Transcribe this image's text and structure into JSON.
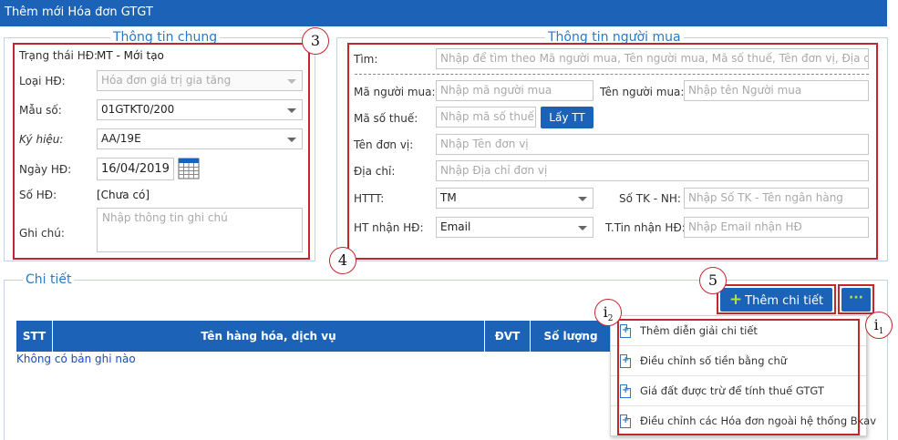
{
  "window": {
    "title": "Thêm mới Hóa đơn GTGT"
  },
  "general": {
    "legend": "Thông tin chung",
    "status_label": "Trạng thái HĐ:",
    "status_value": "MT - Mới tạo",
    "type_label": "Loại HĐ:",
    "type_value": "Hóa đơn giá trị gia tăng",
    "form_label": "Mẫu số:",
    "form_value": "01GTKT0/200",
    "symbol_label": "Ký hiệu:",
    "symbol_value": "AA/19E",
    "date_label": "Ngày HĐ:",
    "date_value": "16/04/2019",
    "number_label": "Số HĐ:",
    "number_value": "[Chưa có]",
    "note_label": "Ghi chú:",
    "note_placeholder": "Nhập thông tin ghi chú"
  },
  "buyer": {
    "legend": "Thông tin người mua",
    "search_label": "Tìm:",
    "search_placeholder": "Nhập để tìm theo Mã người mua, Tên người mua, Mã số thuế, Tên đơn vị, Địa chỉ",
    "code_label": "Mã người mua:",
    "code_placeholder": "Nhập mã người mua",
    "name_label": "Tên người mua:",
    "name_placeholder": "Nhập tên Người mua",
    "tax_label": "Mã số thuế:",
    "tax_placeholder": "Nhập mã số thuế",
    "fetch_button": "Lấy TT",
    "unit_label": "Tên đơn vị:",
    "unit_placeholder": "Nhập Tên đơn vị",
    "address_label": "Địa chỉ:",
    "address_placeholder": "Nhập Địa chỉ đơn vị",
    "payment_label": "HTTT:",
    "payment_value": "TM",
    "account_label": "Số TK - NH:",
    "account_placeholder": "Nhập Số TK - Tên ngân hàng",
    "receive_label": "HT nhận HĐ:",
    "receive_value": "Email",
    "receive_info_label": "T.Tin nhận HĐ:",
    "receive_info_placeholder": "Nhập Email nhận HĐ"
  },
  "detail": {
    "legend": "Chi tiết",
    "add_button": "Thêm chi tiết",
    "more_button": "···",
    "columns": [
      "STT",
      "Tên hàng hóa, dịch vụ",
      "ĐVT",
      "Số lượng"
    ],
    "empty_text": "Không có bản ghi nào"
  },
  "menu": {
    "items": [
      "Thêm diễn giải chi tiết",
      "Điều chỉnh số tiền bằng chữ",
      "Giá đất được trừ để tính thuế GTGT",
      "Điều chỉnh các Hóa đơn ngoài hệ thống Bkav"
    ]
  },
  "callouts": {
    "c3": "3",
    "c4": "4",
    "c5": "5",
    "c_i": "i",
    "c_i1": "1",
    "c_i2": "2"
  },
  "colors": {
    "primary": "#1c63b7",
    "callout_red": "#c4262e",
    "legend_blue": "#2d78c4",
    "accent_green": "#b4e04a"
  }
}
